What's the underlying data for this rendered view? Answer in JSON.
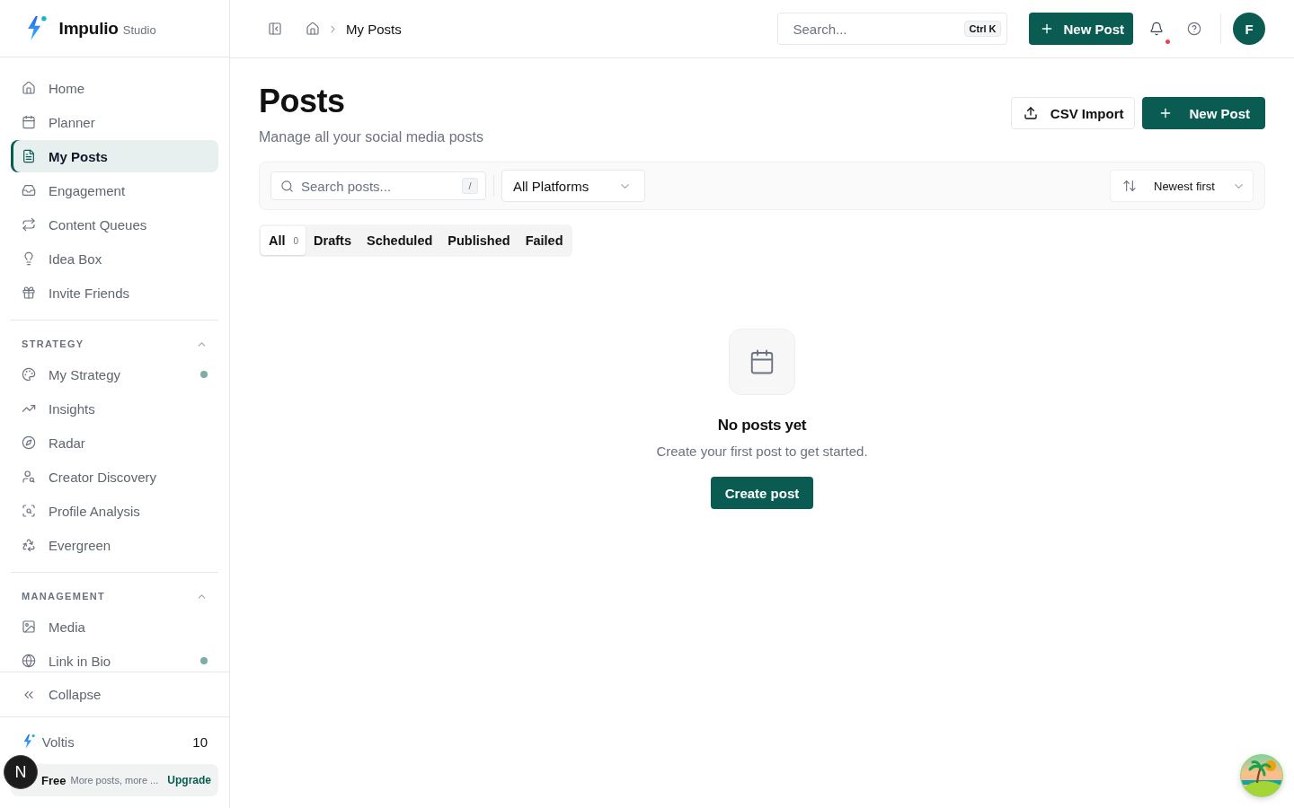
{
  "sidebar": {
    "brand": {
      "name": "Impulio",
      "suffix": "Studio"
    },
    "nav": [
      {
        "label": "Home",
        "selected": false
      },
      {
        "label": "Planner",
        "selected": false
      },
      {
        "label": "My Posts",
        "selected": true
      },
      {
        "label": "Engagement",
        "selected": false
      },
      {
        "label": "Content Queues",
        "selected": false
      },
      {
        "label": "Idea Box",
        "selected": false
      },
      {
        "label": "Invite Friends",
        "selected": false
      }
    ],
    "sections": [
      {
        "title": "STRATEGY",
        "expanded": true,
        "items": [
          {
            "label": "My Strategy",
            "selected": false,
            "dot": true
          },
          {
            "label": "Insights",
            "selected": false,
            "dot": false
          },
          {
            "label": "Radar",
            "selected": false,
            "dot": false
          },
          {
            "label": "Creator Discovery",
            "selected": false,
            "dot": false
          },
          {
            "label": "Profile Analysis",
            "selected": false,
            "dot": false
          },
          {
            "label": "Evergreen",
            "selected": false,
            "dot": false
          }
        ]
      },
      {
        "title": "MANAGEMENT",
        "expanded": true,
        "items": [
          {
            "label": "Media",
            "selected": false,
            "dot": false
          },
          {
            "label": "Link in Bio",
            "selected": false,
            "dot": true
          }
        ]
      }
    ],
    "collapse": {
      "label": "Collapse"
    },
    "credits": {
      "label": "Voltis",
      "count": "10"
    },
    "upgrade": {
      "plan": "Free",
      "text": "More posts, more ...",
      "link": "Upgrade"
    }
  },
  "header": {
    "breadcrumb": [
      "My Posts"
    ],
    "search": {
      "placeholder": "Search...",
      "shortcut": "Ctrl K"
    },
    "new_post": "New Post",
    "notifications": {
      "unread": true
    },
    "avatar": "F"
  },
  "page": {
    "title": "Posts",
    "subtitle": "Manage all your social media posts",
    "actions": [
      {
        "label": "CSV Import",
        "kind": "import"
      },
      {
        "label": "New Post",
        "kind": "primary"
      }
    ],
    "filters": {
      "search": {
        "placeholder": "Search posts...",
        "shortcut": "/"
      },
      "platform": "All Platforms",
      "sort": "Newest first"
    },
    "tabs": [
      {
        "label": "All",
        "count": "0",
        "selected": true
      },
      {
        "label": "Drafts",
        "selected": false
      },
      {
        "label": "Scheduled",
        "selected": false
      },
      {
        "label": "Published",
        "selected": false
      },
      {
        "label": "Failed",
        "selected": false
      }
    ],
    "empty_state": {
      "title": "No posts yet",
      "text": "Create your first post to get started.",
      "button": "Create post"
    }
  },
  "dev_badge": {
    "label": "N"
  }
}
